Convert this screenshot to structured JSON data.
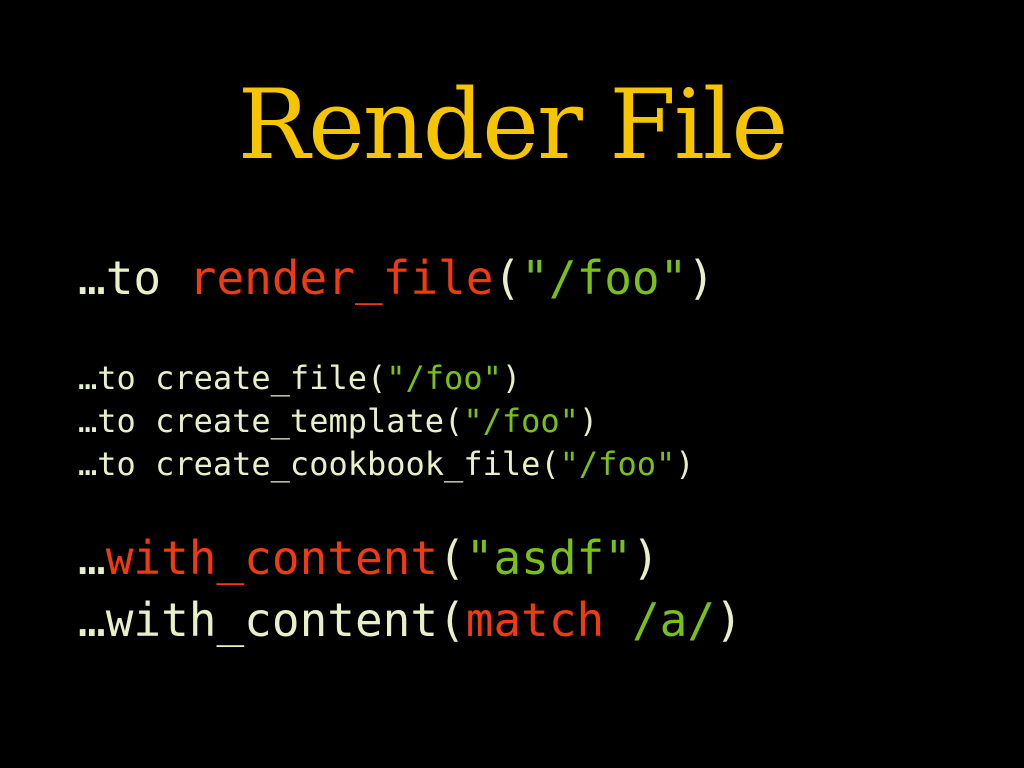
{
  "slide": {
    "title": "Render File",
    "render_line": {
      "prefix": "…to ",
      "method": "render_file",
      "open": "(",
      "arg": "\"/foo\"",
      "close": ")"
    },
    "create_lines": [
      {
        "prefix": "…to ",
        "method": "create_file",
        "open": "(",
        "arg": "\"/foo\"",
        "close": ")"
      },
      {
        "prefix": "…to ",
        "method": "create_template",
        "open": "(",
        "arg": "\"/foo\"",
        "close": ")"
      },
      {
        "prefix": "…to ",
        "method": "create_cookbook_file",
        "open": "(",
        "arg": "\"/foo\"",
        "close": ")"
      }
    ],
    "content_line_1": {
      "prefix": "…",
      "method": "with_content",
      "open": "(",
      "arg": "\"asdf\"",
      "close": ")"
    },
    "content_line_2": {
      "prefix": "…",
      "method": "with_content",
      "open": "(",
      "matcher": "match",
      "space": " ",
      "arg": "/a/",
      "close": ")"
    }
  },
  "colors": {
    "background": "#000000",
    "title": "#f7c500",
    "method_highlight": "#f03a12",
    "string": "#79c11a",
    "text": "#e8f0c8"
  }
}
